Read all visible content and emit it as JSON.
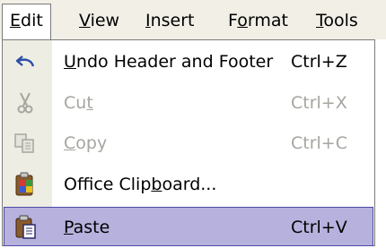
{
  "menubar": {
    "items": [
      {
        "pre": "",
        "u": "E",
        "post": "dit"
      },
      {
        "pre": "",
        "u": "V",
        "post": "iew"
      },
      {
        "pre": "",
        "u": "I",
        "post": "nsert"
      },
      {
        "pre": "F",
        "u": "o",
        "post": "rmat"
      },
      {
        "pre": "",
        "u": "T",
        "post": "ools"
      }
    ]
  },
  "edit_menu": {
    "items": [
      {
        "icon": "undo-icon",
        "pre": "",
        "u": "U",
        "post": "ndo Header and Footer",
        "shortcut": "Ctrl+Z",
        "enabled": true
      },
      {
        "icon": "cut-icon",
        "pre": "Cu",
        "u": "t",
        "post": "",
        "shortcut": "Ctrl+X",
        "enabled": false
      },
      {
        "icon": "copy-icon",
        "pre": "",
        "u": "C",
        "post": "opy",
        "shortcut": "Ctrl+C",
        "enabled": false
      },
      {
        "icon": "office-clipboard-icon",
        "pre": "Office Clip",
        "u": "b",
        "post": "oard...",
        "shortcut": "",
        "enabled": true
      },
      {
        "icon": "paste-icon",
        "pre": "",
        "u": "P",
        "post": "aste",
        "shortcut": "Ctrl+V",
        "enabled": true,
        "highlighted": true
      }
    ]
  },
  "colors": {
    "menubar_bg": "#f1efe6",
    "icon_strip": "#eeede4",
    "highlight_bg": "#b7b2dd",
    "highlight_border": "#4a4aa8",
    "disabled_text": "#a6a6a0"
  }
}
